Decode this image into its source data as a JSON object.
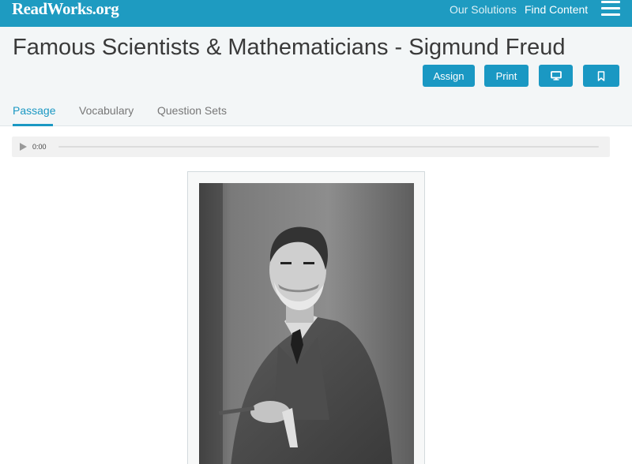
{
  "topbar": {
    "logo": "ReadWorks.org",
    "nav": {
      "solutions": "Our Solutions",
      "find_content": "Find Content"
    }
  },
  "header": {
    "title": "Famous Scientists & Mathematicians - Sigmund Freud",
    "buttons": {
      "assign": "Assign",
      "print": "Print"
    }
  },
  "tabs": {
    "passage": "Passage",
    "vocabulary": "Vocabulary",
    "question_sets": "Question Sets"
  },
  "audio": {
    "time": "0:00"
  },
  "colors": {
    "brand": "#1e9bc1",
    "accent": "#1a98c3",
    "header_bg": "#f3f6f7"
  },
  "icons": [
    "hamburger-menu-icon",
    "monitor-icon",
    "bookmark-icon",
    "play-icon"
  ]
}
